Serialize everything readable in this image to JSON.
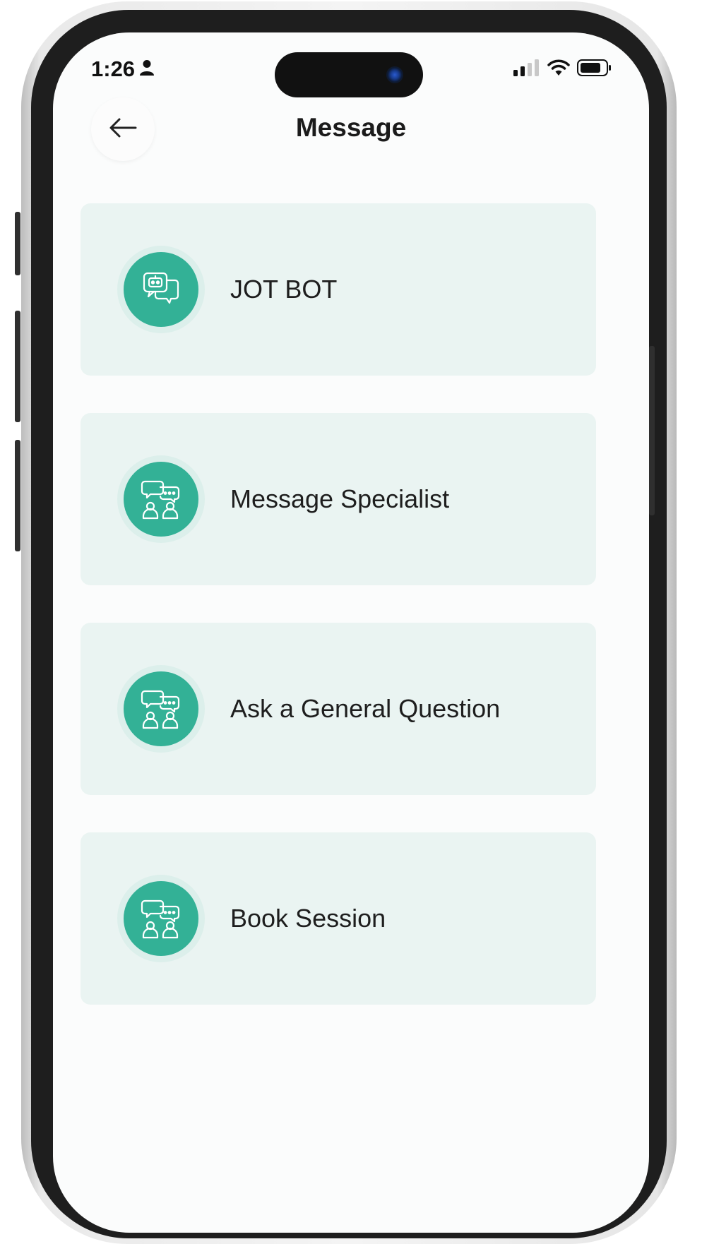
{
  "status_bar": {
    "time": "1:26",
    "person_icon": "person-icon",
    "signal_icon": "cellular-signal-icon",
    "wifi_icon": "wifi-icon",
    "battery_icon": "battery-icon"
  },
  "header": {
    "title": "Message",
    "back_icon": "arrow-left-icon"
  },
  "menu": {
    "items": [
      {
        "label": "JOT BOT",
        "icon": "chatbot-icon"
      },
      {
        "label": "Message Specialist",
        "icon": "people-chat-icon"
      },
      {
        "label": "Ask a General Question",
        "icon": "people-chat-icon"
      },
      {
        "label": "Book Session",
        "icon": "people-chat-icon"
      }
    ]
  },
  "colors": {
    "accent": "#33b196",
    "card_background": "#eaf4f2",
    "screen_background": "#fbfcfc",
    "text": "#1e1e1e"
  }
}
